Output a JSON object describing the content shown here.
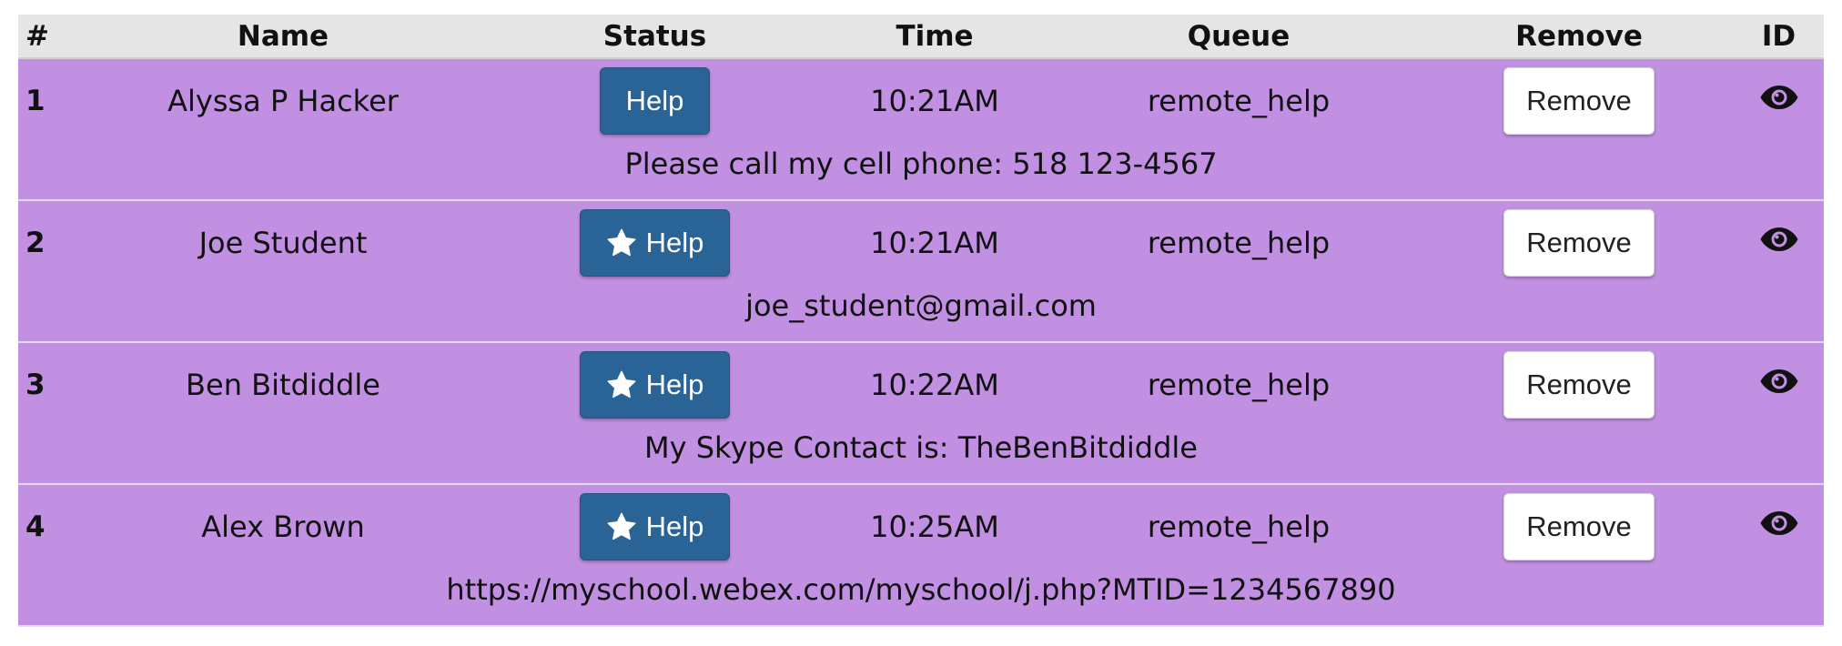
{
  "headers": {
    "num": "#",
    "name": "Name",
    "status": "Status",
    "time": "Time",
    "queue": "Queue",
    "remove": "Remove",
    "id": "ID"
  },
  "colors": {
    "row_bg": "#c190e2",
    "header_bg": "#e5e5e5",
    "help_button": "#2a6496"
  },
  "entries": [
    {
      "num": "1",
      "name": "Alyssa P Hacker",
      "status_label": "Help",
      "status_icon": "none",
      "time": "10:21AM",
      "queue": "remote_help",
      "remove_label": "Remove",
      "id_icon": "eye-icon",
      "contact": "Please call my cell phone: 518 123-4567"
    },
    {
      "num": "2",
      "name": "Joe Student",
      "status_label": "Help",
      "status_icon": "star-icon",
      "time": "10:21AM",
      "queue": "remote_help",
      "remove_label": "Remove",
      "id_icon": "eye-icon",
      "contact": "joe_student@gmail.com"
    },
    {
      "num": "3",
      "name": "Ben Bitdiddle",
      "status_label": "Help",
      "status_icon": "star-icon",
      "time": "10:22AM",
      "queue": "remote_help",
      "remove_label": "Remove",
      "id_icon": "eye-icon",
      "contact": "My Skype Contact is: TheBenBitdiddle"
    },
    {
      "num": "4",
      "name": "Alex Brown",
      "status_label": "Help",
      "status_icon": "star-icon",
      "time": "10:25AM",
      "queue": "remote_help",
      "remove_label": "Remove",
      "id_icon": "eye-icon",
      "contact": "https://myschool.webex.com/myschool/j.php?MTID=1234567890"
    }
  ]
}
